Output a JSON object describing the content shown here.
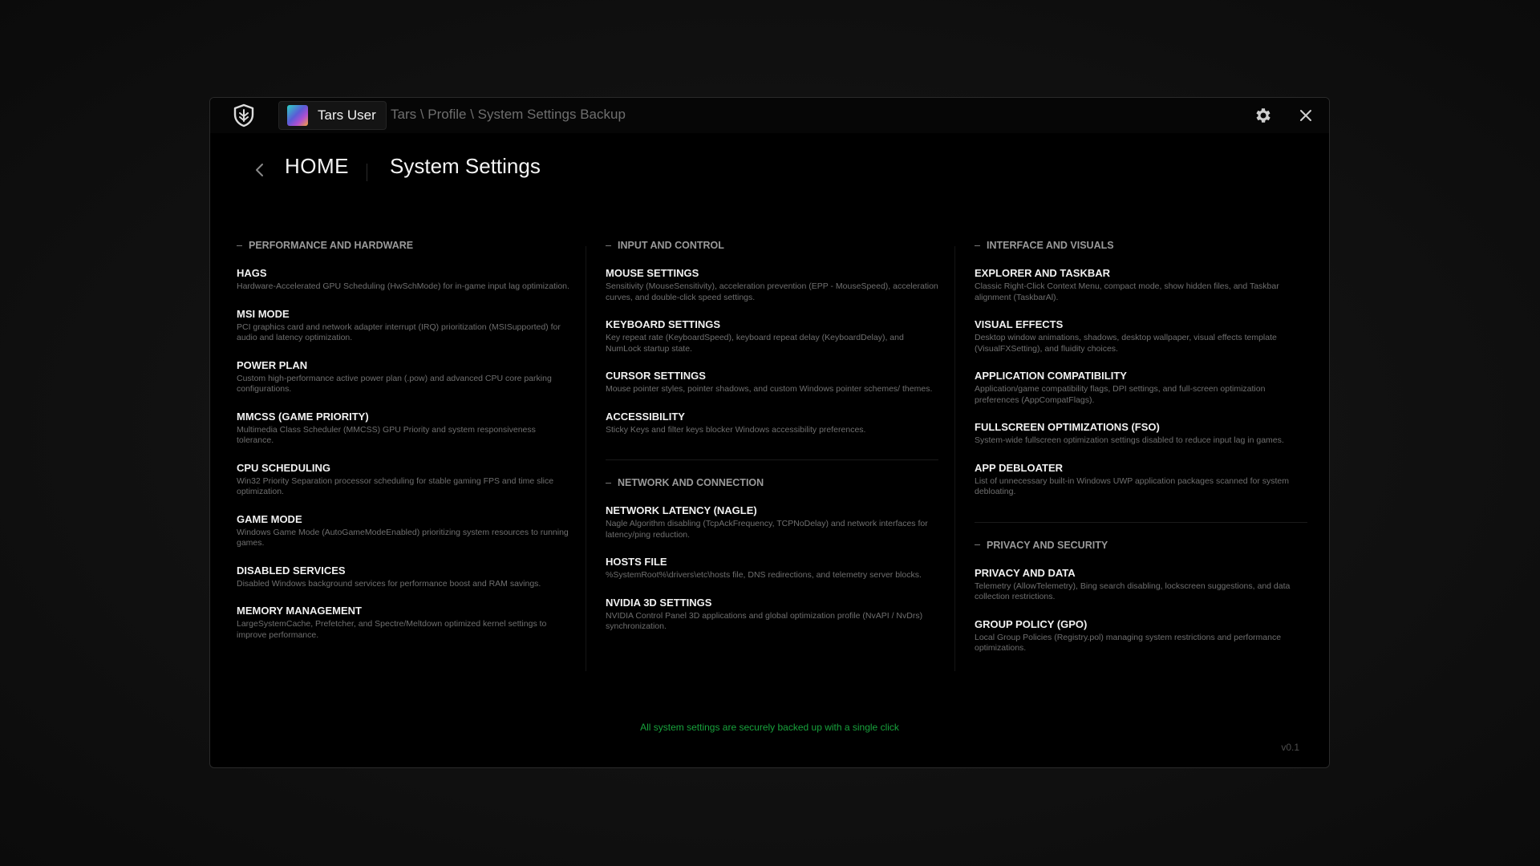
{
  "titlebar": {
    "user_name": "Tars User",
    "breadcrumb": "Tars \\ Profile \\ System Settings Backup",
    "icons": {
      "logo": "shield-icon",
      "settings": "gear-icon",
      "close": "close-icon"
    }
  },
  "header": {
    "home_label": "HOME",
    "page_title": "System Settings"
  },
  "sections": {
    "performance": {
      "title": "PERFORMANCE AND HARDWARE",
      "items": [
        {
          "title": "HAGS",
          "desc": "Hardware-Accelerated GPU Scheduling (HwSchMode) for in-game input lag optimization."
        },
        {
          "title": "MSI MODE",
          "desc": "PCI graphics card and network adapter interrupt (IRQ) prioritization (MSISupported) for audio and latency optimization."
        },
        {
          "title": "POWER PLAN",
          "desc": "Custom high-performance active power plan (.pow) and advanced CPU core parking configurations."
        },
        {
          "title": "MMCSS (GAME PRIORITY)",
          "desc": "Multimedia Class Scheduler (MMCSS) GPU Priority and system responsiveness tolerance."
        },
        {
          "title": "CPU SCHEDULING",
          "desc": "Win32 Priority Separation processor scheduling for stable gaming FPS and time slice optimization."
        },
        {
          "title": "GAME MODE",
          "desc": "Windows Game Mode (AutoGameModeEnabled) prioritizing system resources to running games."
        },
        {
          "title": "DISABLED SERVICES",
          "desc": "Disabled Windows background services for performance boost and RAM savings."
        },
        {
          "title": "MEMORY MANAGEMENT",
          "desc": "LargeSystemCache, Prefetcher, and Spectre/Meltdown optimized kernel settings to improve performance."
        }
      ]
    },
    "input": {
      "title": "INPUT AND CONTROL",
      "items": [
        {
          "title": "MOUSE SETTINGS",
          "desc": "Sensitivity (MouseSensitivity), acceleration prevention (EPP - MouseSpeed), acceleration curves, and double-click speed settings."
        },
        {
          "title": "KEYBOARD SETTINGS",
          "desc": "Key repeat rate (KeyboardSpeed), keyboard repeat delay (KeyboardDelay), and NumLock startup state."
        },
        {
          "title": "CURSOR SETTINGS",
          "desc": "Mouse pointer styles, pointer shadows, and custom Windows pointer schemes/ themes."
        },
        {
          "title": "ACCESSIBILITY",
          "desc": "Sticky Keys and filter keys blocker Windows accessibility preferences."
        }
      ]
    },
    "network": {
      "title": "NETWORK AND CONNECTION",
      "items": [
        {
          "title": "NETWORK LATENCY (NAGLE)",
          "desc": "Nagle Algorithm disabling (TcpAckFrequency, TCPNoDelay) and network interfaces for latency/ping reduction."
        },
        {
          "title": "HOSTS FILE",
          "desc": "%SystemRoot%\\drivers\\etc\\hosts file, DNS redirections, and telemetry server blocks."
        },
        {
          "title": "NVIDIA 3D SETTINGS",
          "desc": "NVIDIA Control Panel 3D applications and global optimization profile (NvAPI / NvDrs) synchronization."
        }
      ]
    },
    "interface": {
      "title": "INTERFACE AND VISUALS",
      "items": [
        {
          "title": "EXPLORER AND TASKBAR",
          "desc": "Classic Right-Click Context Menu, compact mode, show hidden files, and Taskbar alignment (TaskbarAl)."
        },
        {
          "title": "VISUAL EFFECTS",
          "desc": "Desktop window animations, shadows, desktop wallpaper, visual effects template (VisualFXSetting), and fluidity choices."
        },
        {
          "title": "APPLICATION COMPATIBILITY",
          "desc": "Application/game compatibility flags, DPI settings, and full-screen optimization preferences (AppCompatFlags)."
        },
        {
          "title": "FULLSCREEN OPTIMIZATIONS (FSO)",
          "desc": "System-wide fullscreen optimization settings disabled to reduce input lag in games."
        },
        {
          "title": "APP DEBLOATER",
          "desc": "List of unnecessary built-in Windows UWP application packages scanned for system debloating."
        }
      ]
    },
    "privacy": {
      "title": "PRIVACY AND SECURITY",
      "items": [
        {
          "title": "PRIVACY AND DATA",
          "desc": "Telemetry (AllowTelemetry), Bing search disabling, lockscreen suggestions, and data collection restrictions."
        },
        {
          "title": "GROUP POLICY (GPO)",
          "desc": "Local Group Policies (Registry.pol) managing system restrictions and performance optimizations."
        }
      ]
    }
  },
  "footer": {
    "message": "All system settings are securely backed up with a single click",
    "version": "v0.1",
    "accent_color": "#18a23c"
  }
}
